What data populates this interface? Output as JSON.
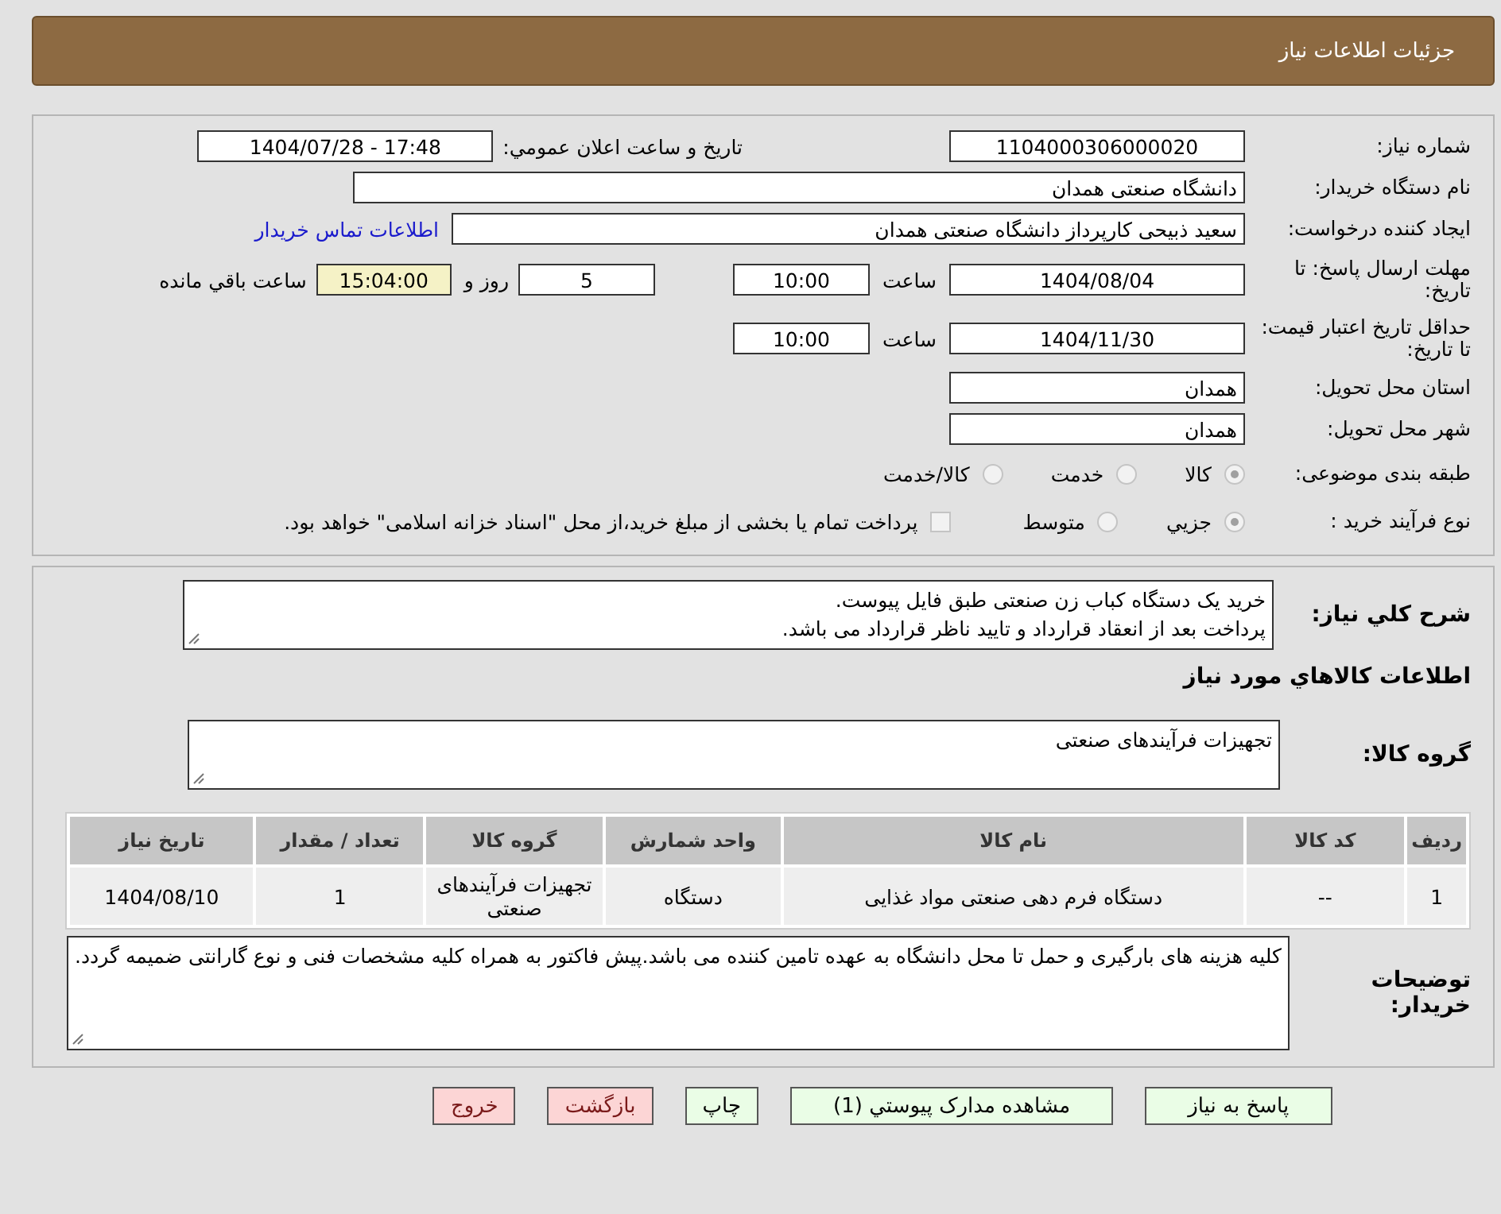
{
  "header": {
    "title": "جزئیات اطلاعات نیاز"
  },
  "details": {
    "need_number": {
      "label": "شماره نیاز:",
      "value": "1104000306000020"
    },
    "announce": {
      "label": "تاریخ و ساعت اعلان عمومي:",
      "value": "1404/07/28 - 17:48"
    },
    "buyer": {
      "label": "نام دستگاه خریدار:",
      "value": "دانشگاه صنعتی همدان"
    },
    "creator": {
      "label": "ایجاد کننده درخواست:",
      "value": "سعید ذبیحی کارپرداز دانشگاه صنعتی همدان",
      "link": "اطلاعات تماس خریدار"
    },
    "deadline": {
      "label": "مهلت ارسال پاسخ: تا تاریخ:",
      "date": "1404/08/04",
      "time_label": "ساعت",
      "time": "10:00",
      "days": "5",
      "days_label": "روز و",
      "remaining": "15:04:00",
      "remaining_label": "ساعت باقي مانده"
    },
    "validity": {
      "label": "حداقل تاریخ اعتبار قیمت: تا تاریخ:",
      "date": "1404/11/30",
      "time_label": "ساعت",
      "time": "10:00"
    },
    "province": {
      "label": "استان محل تحویل:",
      "value": "همدان"
    },
    "city": {
      "label": "شهر محل تحویل:",
      "value": "همدان"
    },
    "category": {
      "label": "طبقه بندی موضوعی:",
      "options": [
        {
          "label": "کالا",
          "selected": true
        },
        {
          "label": "خدمت",
          "selected": false
        },
        {
          "label": "کالا/خدمت",
          "selected": false
        }
      ]
    },
    "process": {
      "label": "نوع فرآیند خرید :",
      "options": [
        {
          "label": "جزيي",
          "selected": true
        },
        {
          "label": "متوسط",
          "selected": false
        }
      ],
      "payment": {
        "label": "پرداخت تمام یا بخشی از مبلغ خرید،از محل \"اسناد خزانه اسلامی\" خواهد بود.",
        "checked": false
      }
    }
  },
  "needs": {
    "summary": {
      "label": "شرح کلي نیاز:",
      "lines": [
        "خرید یک دستگاه کباب زن صنعتی طبق فایل پیوست.",
        "پرداخت بعد از انعقاد قرارداد و تایید ناظر قرارداد می باشد."
      ]
    },
    "goods_heading": "اطلاعات کالاهاي مورد نیاز",
    "goods_group": {
      "label": "گروه کالا:",
      "value": "تجهیزات فرآیندهای صنعتی"
    },
    "table": {
      "columns": [
        "ردیف",
        "کد کالا",
        "نام کالا",
        "واحد شمارش",
        "گروه کالا",
        "تعداد / مقدار",
        "تاریخ نیاز"
      ],
      "rows": [
        [
          "1",
          "--",
          "دستگاه فرم دهی صنعتی مواد غذایی",
          "دستگاه",
          "تجهیزات فرآیندهای صنعتی",
          "1",
          "1404/08/10"
        ]
      ]
    },
    "buyer_notes": {
      "label": "توضیحات خریدار:",
      "value": "کلیه هزینه های بارگیری و حمل تا محل دانشگاه به عهده تامین کننده می باشد.پیش فاکتور به همراه کلیه مشخصات فنی و نوع گارانتی ضمیمه گردد."
    }
  },
  "buttons": [
    {
      "label": "پاسخ به نیاز",
      "kind": "primary"
    },
    {
      "label": "مشاهده مدارک پیوستي (1)",
      "kind": "primary"
    },
    {
      "label": "چاپ",
      "kind": "primary"
    },
    {
      "label": "بازگشت",
      "kind": "danger"
    },
    {
      "label": "خروج",
      "kind": "danger"
    }
  ]
}
